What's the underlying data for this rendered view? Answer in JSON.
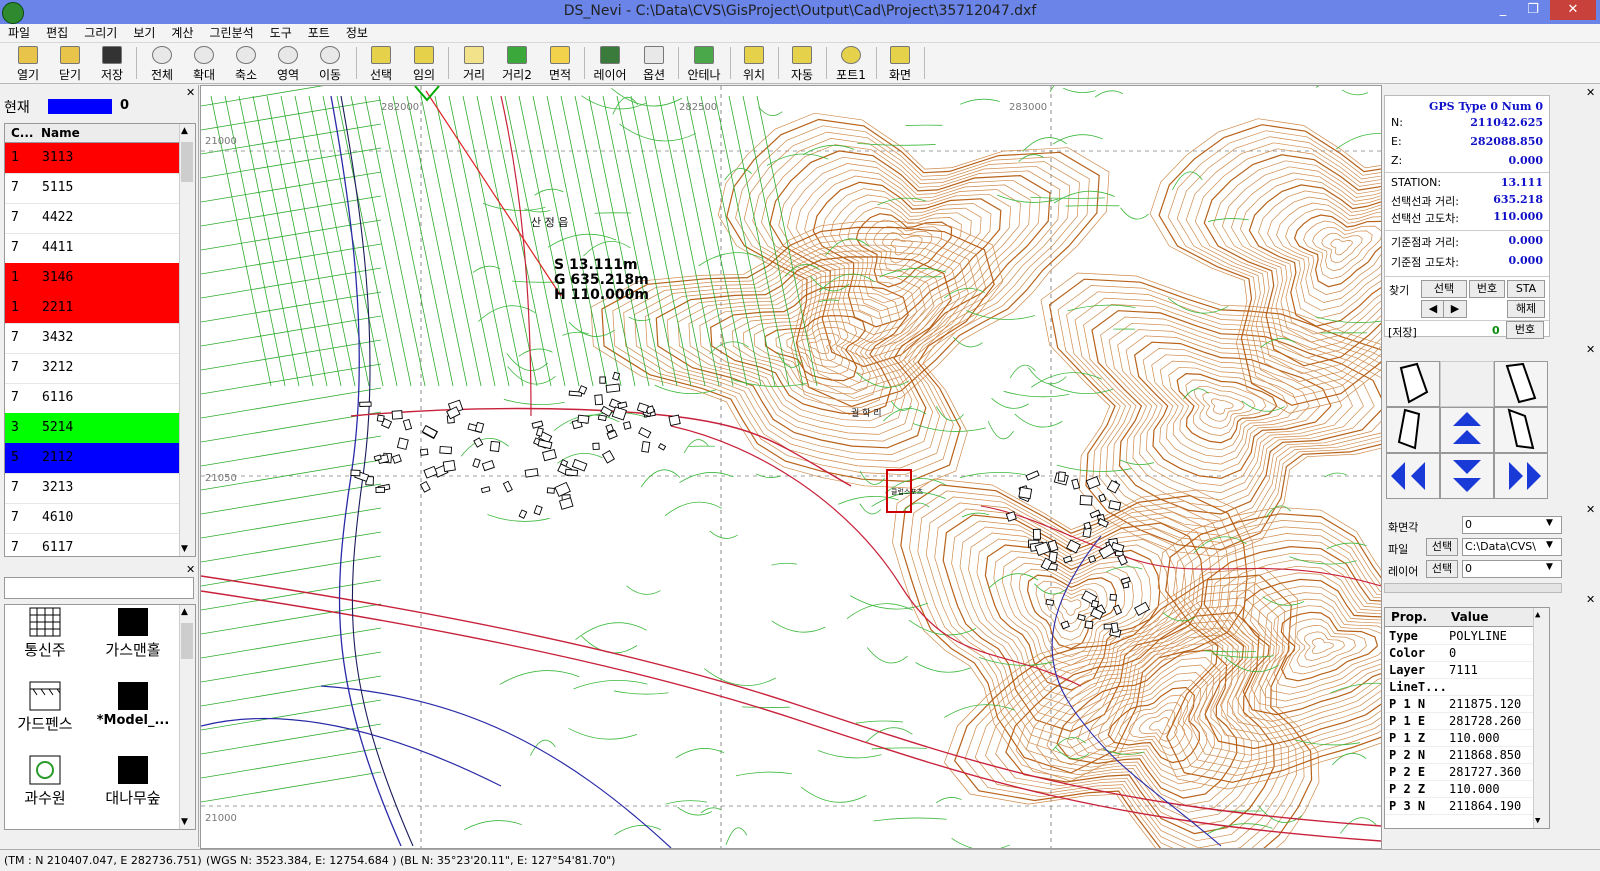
{
  "window": {
    "title": "DS_Nevi - C:\\Data\\CVS\\GisProject\\Output\\Cad\\Project\\35712047.dxf",
    "controls": [
      "_",
      "❐",
      "✕"
    ]
  },
  "menu": [
    "파일",
    "편집",
    "그리기",
    "보기",
    "계산",
    "그린분석",
    "도구",
    "포트",
    "정보"
  ],
  "toolbar": [
    {
      "label": "열기",
      "icon": "open-folder-icon"
    },
    {
      "label": "닫기",
      "icon": "close-folder-icon"
    },
    {
      "label": "저장",
      "icon": "save-disk-icon"
    },
    {
      "label": "전체",
      "icon": "zoom-all-icon"
    },
    {
      "label": "확대",
      "icon": "zoom-in-icon"
    },
    {
      "label": "축소",
      "icon": "zoom-out-icon"
    },
    {
      "label": "영역",
      "icon": "zoom-window-icon"
    },
    {
      "label": "이동",
      "icon": "pan-icon"
    },
    {
      "label": "선택",
      "icon": "select-icon"
    },
    {
      "label": "임의",
      "icon": "arbitrary-icon"
    },
    {
      "label": "거리",
      "icon": "distance-icon"
    },
    {
      "label": "거리2",
      "icon": "distance2-icon"
    },
    {
      "label": "면적",
      "icon": "area-icon"
    },
    {
      "label": "레이어",
      "icon": "layer-icon"
    },
    {
      "label": "옵션",
      "icon": "options-icon"
    },
    {
      "label": "안테나",
      "icon": "antenna-icon"
    },
    {
      "label": "위치",
      "icon": "position-icon"
    },
    {
      "label": "자동",
      "icon": "auto-icon"
    },
    {
      "label": "포트1",
      "icon": "port-icon"
    },
    {
      "label": "화면",
      "icon": "screen-icon"
    }
  ],
  "left": {
    "current_label": "현재",
    "current_value": "0",
    "current_color": "#0000ff",
    "columns": [
      "C...",
      "Name"
    ],
    "layers": [
      {
        "c": "1",
        "name": "3113",
        "color": "#ff0000"
      },
      {
        "c": "7",
        "name": "5115",
        "color": ""
      },
      {
        "c": "7",
        "name": "4422",
        "color": ""
      },
      {
        "c": "7",
        "name": "4411",
        "color": ""
      },
      {
        "c": "1",
        "name": "3146",
        "color": "#ff0000"
      },
      {
        "c": "1",
        "name": "2211",
        "color": "#ff0000"
      },
      {
        "c": "7",
        "name": "3432",
        "color": ""
      },
      {
        "c": "7",
        "name": "3212",
        "color": ""
      },
      {
        "c": "7",
        "name": "6116",
        "color": ""
      },
      {
        "c": "3",
        "name": "5214",
        "color": "#00ff00"
      },
      {
        "c": "5",
        "name": "2112",
        "color": "#0000ff"
      },
      {
        "c": "7",
        "name": "3213",
        "color": ""
      },
      {
        "c": "7",
        "name": "4610",
        "color": ""
      },
      {
        "c": "7",
        "name": "6117",
        "color": ""
      }
    ],
    "symbols": [
      {
        "label": "통신주",
        "kind": "grid"
      },
      {
        "label": "가스맨홀",
        "kind": "black"
      },
      {
        "label": "가드펜스",
        "kind": "fence"
      },
      {
        "label": "*Model_...",
        "kind": "black"
      },
      {
        "label": "과수원",
        "kind": "circle"
      },
      {
        "label": "대나무숲",
        "kind": "black"
      }
    ]
  },
  "map": {
    "grid_labels": [
      "282000",
      "282500",
      "283000",
      "21000",
      "21050",
      "21000"
    ],
    "measure": [
      "S 13.111m",
      "G 635.218m",
      "H 110.000m"
    ],
    "place_labels": [
      "산 정 읍",
      "궐 학 리",
      "클럽스포츠"
    ]
  },
  "right": {
    "gps_header": "GPS Type 0   Num 0",
    "rows": [
      {
        "k": "N:",
        "v": "211042.625"
      },
      {
        "k": "E:",
        "v": "282088.850"
      },
      {
        "k": "Z:",
        "v": "0.000"
      },
      {
        "k": "STATION:",
        "v": "13.111"
      },
      {
        "k": "선택선과 거리:",
        "v": "635.218"
      },
      {
        "k": "선택선 고도차:",
        "v": "110.000"
      },
      {
        "k": "기준점과 거리:",
        "v": "0.000"
      },
      {
        "k": "기준점 고도차:",
        "v": "0.000"
      }
    ],
    "find_label": "찾기",
    "select_btn": "선택",
    "number_btn": "번호",
    "sta_btn": "STA",
    "release_btn": "해제",
    "prev_btn": "◀",
    "next_btn": "▶",
    "save_label": "[저장]",
    "save_value": "0",
    "save_number_btn": "번호",
    "screen_angle_label": "화면각",
    "screen_angle_value": "0",
    "file_label": "파일",
    "file_select": "선택",
    "file_value": "C:\\Data\\CVS\\",
    "layer_label": "레이어",
    "layer_select": "선택",
    "layer_value": "0",
    "prop_headers": [
      "Prop.",
      "Value"
    ],
    "props": [
      {
        "k": "Type",
        "v": "POLYLINE"
      },
      {
        "k": "Color",
        "v": "0"
      },
      {
        "k": "Layer",
        "v": "7111"
      },
      {
        "k": "LineT...",
        "v": ""
      },
      {
        "k": "P 1 N",
        "v": "211875.120"
      },
      {
        "k": "P 1 E",
        "v": "281728.260"
      },
      {
        "k": "P 1 Z",
        "v": "110.000"
      },
      {
        "k": "P 2 N",
        "v": "211868.850"
      },
      {
        "k": "P 2 E",
        "v": "281727.360"
      },
      {
        "k": "P 2 Z",
        "v": "110.000"
      },
      {
        "k": "P 3 N",
        "v": "211864.190"
      }
    ]
  },
  "status": {
    "tm": "(TM : N 210407.047, E 282736.751)",
    "wgs": "(WGS N: 3523.384, E: 12754.684 )",
    "bl": "(BL N: 35°23'20.11\", E: 127°54'81.70\")"
  }
}
